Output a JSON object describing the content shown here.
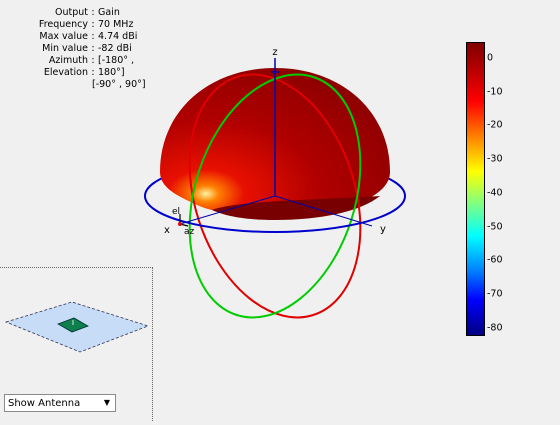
{
  "info": {
    "rows": [
      {
        "key": "Output",
        "value": "Gain"
      },
      {
        "key": "Frequency",
        "value": "70 MHz"
      },
      {
        "key": "Max value",
        "value": "4.74 dBi"
      },
      {
        "key": "Min value",
        "value": "-82 dBi"
      },
      {
        "key": "Azimuth",
        "value": "[-180° ,"
      },
      {
        "key": "Elevation",
        "value": "180°]"
      }
    ],
    "continuation": "[-90° , 90°]"
  },
  "axes": {
    "x": "x",
    "y": "y",
    "z": "z",
    "el": "el",
    "az": "az"
  },
  "colorbar": {
    "ticks": [
      "0",
      "-10",
      "-20",
      "-30",
      "-40",
      "-50",
      "-60",
      "-70",
      "-80"
    ]
  },
  "colors": {
    "dome": "#a00000",
    "azimuth_ring": "#0000cc",
    "elevation_ring_red": "#e00000",
    "elevation_ring_green": "#00cc00"
  },
  "dropdown": {
    "selected": "Show Antenna"
  }
}
